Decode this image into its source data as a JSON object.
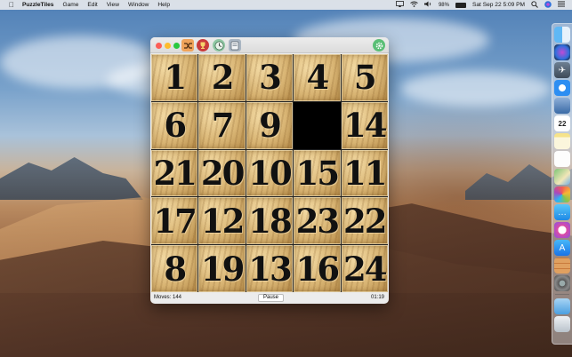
{
  "menubar": {
    "app_name": "PuzzleTiles",
    "menus": [
      "Game",
      "Edit",
      "View",
      "Window",
      "Help"
    ],
    "battery_percent": "98%",
    "battery_level": 0.98,
    "datetime": "Sat Sep 22  5:09 PM"
  },
  "window": {
    "toolbar_icons": [
      "shuffle-icon",
      "trophy-icon",
      "clock-icon",
      "photo-icon"
    ],
    "settings_icon": "gear-icon",
    "tiles": [
      "1",
      "2",
      "3",
      "4",
      "5",
      "6",
      "7",
      "9",
      "",
      "14",
      "21",
      "20",
      "10",
      "15",
      "11",
      "17",
      "12",
      "18",
      "23",
      "22",
      "8",
      "19",
      "13",
      "16",
      "24"
    ],
    "status": {
      "moves": "Moves: 144",
      "pause_label": "Pause",
      "timer": "01:19"
    }
  },
  "dock": {
    "icons": [
      "finder-icon",
      "siri-icon",
      "launchpad-icon",
      "safari-icon",
      "preview-icon",
      "calendar-icon",
      "notes-icon",
      "reminders-icon",
      "maps-icon",
      "photos-icon",
      "messages-icon",
      "itunes-icon",
      "app-store-icon",
      "puzzletiles-icon",
      "system-preferences-icon",
      "downloads-icon",
      "trash-icon"
    ],
    "calendar_date": "22"
  },
  "colors": {
    "accent": "#3b82f6",
    "tile": "#d9b574",
    "empty_tile": "#000000"
  }
}
